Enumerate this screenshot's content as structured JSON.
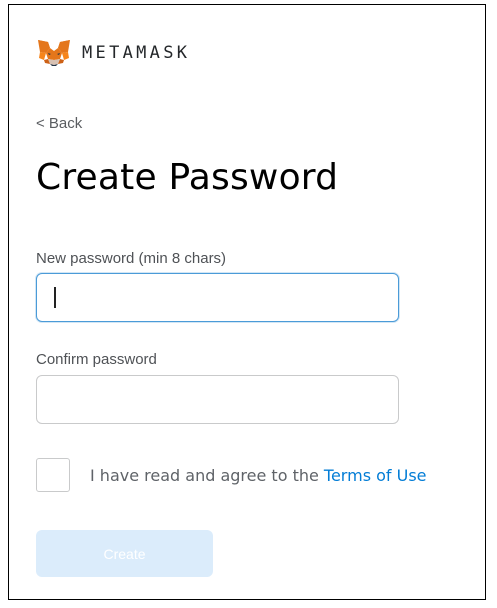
{
  "brand": {
    "wordmark": "METAMASK",
    "logo_icon": "metamask-fox-icon"
  },
  "nav": {
    "back_label": "< Back"
  },
  "page": {
    "title": "Create Password"
  },
  "form": {
    "new_password": {
      "label": "New password (min 8 chars)",
      "value": ""
    },
    "confirm_password": {
      "label": "Confirm password",
      "value": ""
    },
    "terms": {
      "text": "I have read and agree to the ",
      "link_text": "Terms of Use",
      "checked": false
    },
    "submit": {
      "label": "Create",
      "disabled": true
    }
  },
  "colors": {
    "link": "#037dd6",
    "focus_border": "#4b9bd8",
    "disabled_button_bg": "#dbecfb",
    "input_border": "#c9cacb"
  }
}
